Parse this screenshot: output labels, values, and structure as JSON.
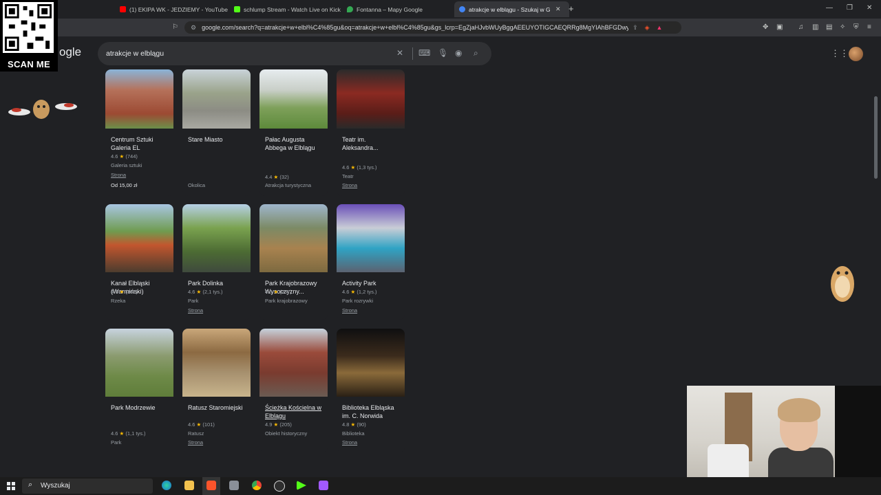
{
  "browser": {
    "tabs": [
      {
        "title": "(1) EKIPA WK - JEDZIEMY - YouTube",
        "favicon_color": "#ff0000"
      },
      {
        "title": "schlump Stream - Watch Live on Kick",
        "favicon_color": "#53fc18"
      },
      {
        "title": "Fontanna – Mapy Google",
        "favicon_color": "#34a853"
      },
      {
        "title": "atrakcje w elblągu - Szukaj w Go",
        "favicon_color": "#4285f4"
      }
    ],
    "url": "google.com/search?q=atrakcje+w+elbl%C4%85gu&oq=atrakcje+w+elbl%C4%85gu&gs_lcrp=EgZjaHJvbWUyBggAEEUYOTIGCAEQRRg8MgYIAhBFGDwyBggDEEUYP..."
  },
  "overlay": {
    "qr_label": "SCAN ME"
  },
  "search": {
    "logo_partial": "ogle",
    "query": "atrakcje w elblągu"
  },
  "cards": [
    {
      "name": "Centrum Sztuki Galeria EL",
      "rating": "4.6",
      "reviews": "(744)",
      "category": "Galeria sztuki",
      "link": "Strona",
      "price": "Od 15,00 zł",
      "img": "linear-gradient(180deg,#8ab4d8 0%,#b5715a 35%,#9c4a33 75%,#6b8f4a 100%)"
    },
    {
      "name": "Stare Miasto",
      "rating": "",
      "reviews": "",
      "category": "Okolica",
      "link": "",
      "price": "",
      "img": "linear-gradient(180deg,#c9d3d9 0%,#9aa38a 40%,#8c8c84 70%,#a9a9a2 100%)"
    },
    {
      "name": "Pałac Augusta Abbega w Elblągu",
      "rating": "4.4",
      "reviews": "(32)",
      "category": "Atrakcja turystyczna",
      "link": "",
      "price": "",
      "img": "linear-gradient(180deg,#e7ecef 0%,#c9cfc8 35%,#7ea05a 65%,#5d8a3b 100%)"
    },
    {
      "name": "Teatr im. Aleksandra...",
      "rating": "4.6",
      "reviews": "(1,3 tys.)",
      "category": "Teatr",
      "link": "Strona",
      "price": "",
      "img": "linear-gradient(180deg,#2b2b2b 0%,#8b2a22 40%,#5a1d18 75%,#2a2a2a 100%)"
    },
    {
      "name": "Kanał Elbląski (Warmiński)",
      "rating": "4.7",
      "reviews": "(367)",
      "category": "Rzeka",
      "link": "",
      "price": "",
      "img": "linear-gradient(180deg,#a8c6e2 0%,#6f9b4f 40%,#c2562e 60%,#4c3c2e 100%)"
    },
    {
      "name": "Park Dolinka",
      "rating": "4.6",
      "reviews": "(2,1 tys.)",
      "category": "Park",
      "link": "Strona",
      "price": "",
      "img": "linear-gradient(180deg,#b6d0e6 0%,#7aa24f 35%,#4c6b33 70%,#3f4a3d 100%)"
    },
    {
      "name": "Park Krajobrazowy Wysoczyzny...",
      "rating": "4.6",
      "reviews": "(257)",
      "category": "Park krajobrazowy",
      "link": "",
      "price": "",
      "img": "linear-gradient(180deg,#9fb6cc 0%,#7c8a65 35%,#a8824f 65%,#7d6a40 100%)"
    },
    {
      "name": "Activity Park",
      "rating": "4.6",
      "reviews": "(1,2 tys.)",
      "category": "Park rozrywki",
      "link": "Strona",
      "price": "",
      "img": "linear-gradient(180deg,#6a4fb8 0%,#c9cdd6 35%,#2fa3c4 65%,#5b6270 100%)"
    },
    {
      "name": "Park Modrzewie",
      "rating": "4.6",
      "reviews": "(1,1 tys.)",
      "category": "Park",
      "link": "",
      "price": "",
      "img": "linear-gradient(180deg,#c7d3de 0%,#8b9b6f 40%,#6e8a48 70%,#5f7d3a 100%)"
    },
    {
      "name": "Ratusz Staromiejski",
      "rating": "4.6",
      "reviews": "(101)",
      "category": "Ratusz",
      "link": "Strona",
      "price": "",
      "img": "linear-gradient(180deg,#c9a77a 0%,#8c6a42 35%,#a7916f 65%,#c8b48c 100%)"
    },
    {
      "name": "Ścieżka Kościelna w Elblągu",
      "rating": "4.9",
      "reviews": "(205)",
      "category": "Obiekt historyczny",
      "link": "",
      "price": "",
      "img": "linear-gradient(180deg,#c6d2dc 0%,#9a4b3b 35%,#7a3b2f 65%,#6b5b52 100%)"
    },
    {
      "name": "Biblioteka Elbląska im. C. Norwida",
      "rating": "4.8",
      "reviews": "(90)",
      "category": "Biblioteka",
      "link": "Strona",
      "price": "",
      "img": "linear-gradient(180deg,#0f0f10 0%,#3b2b1c 40%,#8a6a3a 65%,#2a2015 100%)"
    }
  ],
  "taskbar": {
    "search_placeholder": "Wyszukaj"
  }
}
